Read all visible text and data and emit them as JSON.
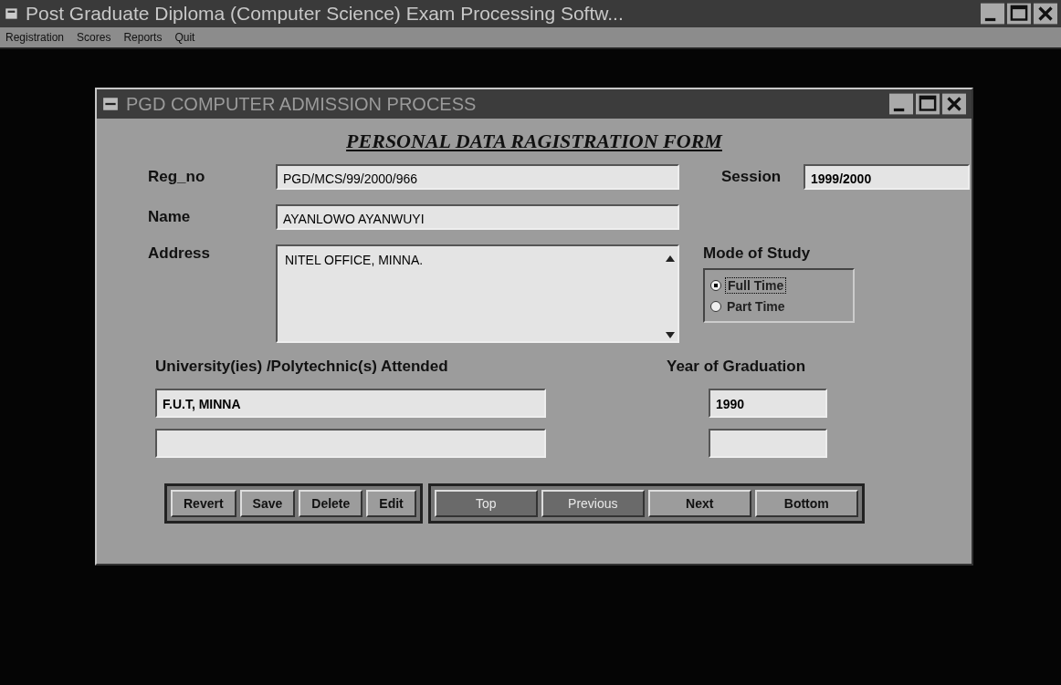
{
  "window": {
    "title": "Post Graduate Diploma (Computer Science) Exam Processing Softw..."
  },
  "menu": [
    "Registration",
    "Scores",
    "Reports",
    "Quit"
  ],
  "child_window": {
    "title": "PGD COMPUTER ADMISSION PROCESS"
  },
  "form": {
    "heading": "PERSONAL DATA RAGISTRATION FORM",
    "reg_no": {
      "label": "Reg_no",
      "value": "PGD/MCS/99/2000/966"
    },
    "session": {
      "label": "Session",
      "value": "1999/2000"
    },
    "name": {
      "label": "Name",
      "value": "AYANLOWO AYANWUYI"
    },
    "address": {
      "label": "Address",
      "value": "NITEL OFFICE, MINNA."
    },
    "mode_of_study": {
      "label": "Mode of Study",
      "options": [
        {
          "label": "Full Time",
          "selected": true
        },
        {
          "label": "Part Time",
          "selected": false
        }
      ]
    },
    "education": {
      "columns": [
        "University(ies) /Polytechnic(s) Attended",
        "Year of Graduation"
      ],
      "rows": [
        {
          "institution": "F.U.T, MINNA",
          "year": "1990"
        },
        {}
      ]
    },
    "record_buttons": [
      {
        "label": "Revert",
        "disabled": false
      },
      {
        "label": "Save",
        "disabled": false
      },
      {
        "label": "Delete",
        "disabled": false
      },
      {
        "label": "Edit",
        "disabled": false
      }
    ],
    "nav_buttons": [
      {
        "label": "Top",
        "disabled": true
      },
      {
        "label": "Previous",
        "disabled": true
      },
      {
        "label": "Next",
        "disabled": false
      },
      {
        "label": "Bottom",
        "disabled": false
      }
    ]
  }
}
